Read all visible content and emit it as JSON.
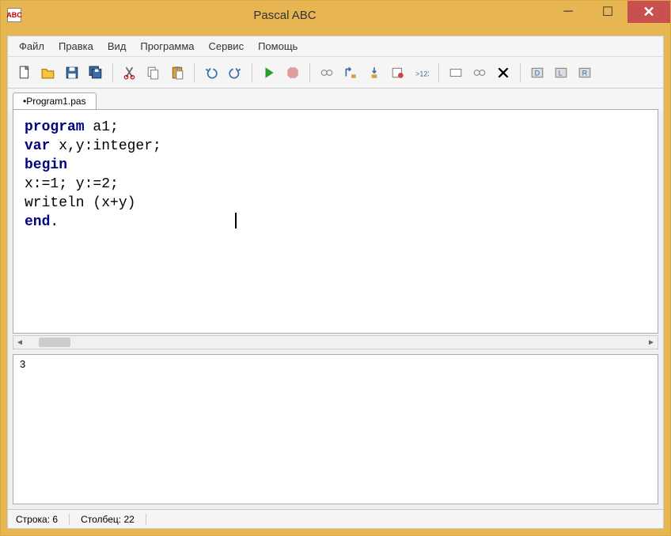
{
  "window": {
    "title": "Pascal ABC",
    "app_icon_text": "ABC"
  },
  "menu": {
    "file": "Файл",
    "edit": "Правка",
    "view": "Вид",
    "program": "Программа",
    "service": "Сервис",
    "help": "Помощь"
  },
  "toolbar_icons": {
    "new": "new-file-icon",
    "open": "open-file-icon",
    "save": "save-icon",
    "save_all": "save-all-icon",
    "cut": "cut-icon",
    "copy": "copy-icon",
    "paste": "paste-icon",
    "undo": "undo-icon",
    "redo": "redo-icon",
    "run": "run-icon",
    "stop": "stop-icon",
    "step": "step-icon",
    "step_over": "step-over-icon",
    "step_into": "step-into-icon",
    "breakpoint": "breakpoint-icon",
    "eval": "eval-icon",
    "watch": "watch-icon",
    "locals": "locals-icon",
    "delete": "delete-icon",
    "d1": "tool-d1-icon",
    "d2": "tool-d2-icon",
    "d3": "tool-d3-icon"
  },
  "tabs": {
    "active": "•Program1.pas"
  },
  "code": {
    "line1_kw": "program",
    "line1_rest": " a1;",
    "line2_kw": "var",
    "line2_rest": " x,y:integer;",
    "line3_kw": "begin",
    "line4": "x:=1; y:=2;",
    "line5": "writeln (x+y)",
    "line6_kw": "end",
    "line6_rest": "."
  },
  "output": {
    "text": "3"
  },
  "status": {
    "line_label": "Строка:",
    "line_value": "6",
    "col_label": "Столбец:",
    "col_value": "22"
  }
}
